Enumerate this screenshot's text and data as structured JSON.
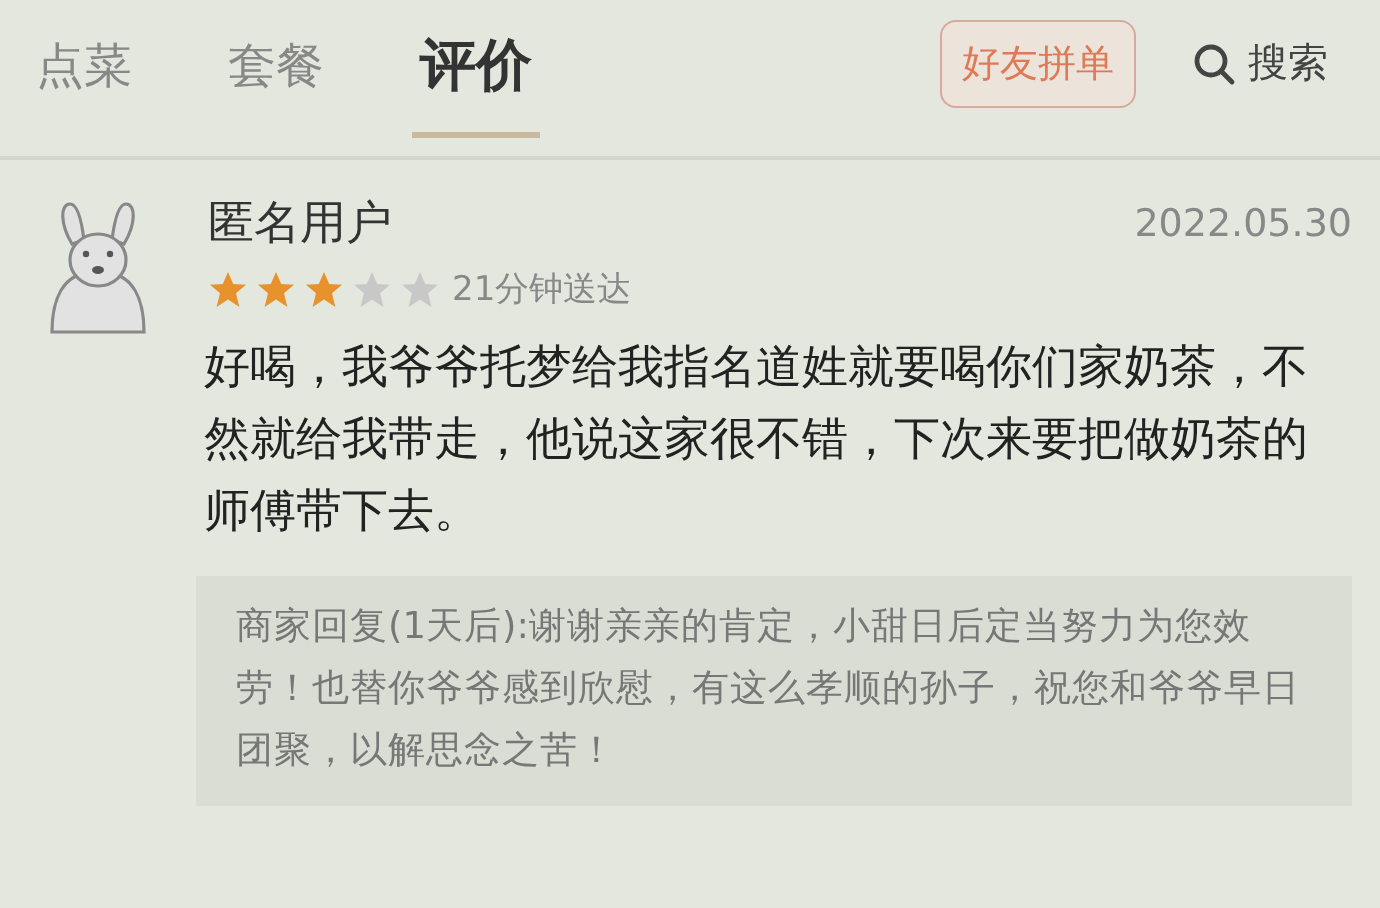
{
  "tabs": [
    {
      "label": "点菜",
      "selected": false
    },
    {
      "label": "套餐",
      "selected": false
    },
    {
      "label": "评价",
      "selected": true
    }
  ],
  "group_order_button": "好友拼单",
  "search": {
    "label": "搜索"
  },
  "review": {
    "user": "匿名用户",
    "date": "2022.05.30",
    "stars": 3,
    "delivery": "21分钟送达",
    "text": "好喝，我爷爷托梦给我指名道姓就要喝你们家奶茶，不然就给我带走，他说这家很不错，下次来要把做奶茶的师傅带下去。",
    "reply": "商家回复(1天后):谢谢亲亲的肯定，小甜日后定当努力为您效劳！也替你爷爷感到欣慰，有这么孝顺的孙子，祝您和爷爷早日团聚，以解思念之苦！"
  }
}
